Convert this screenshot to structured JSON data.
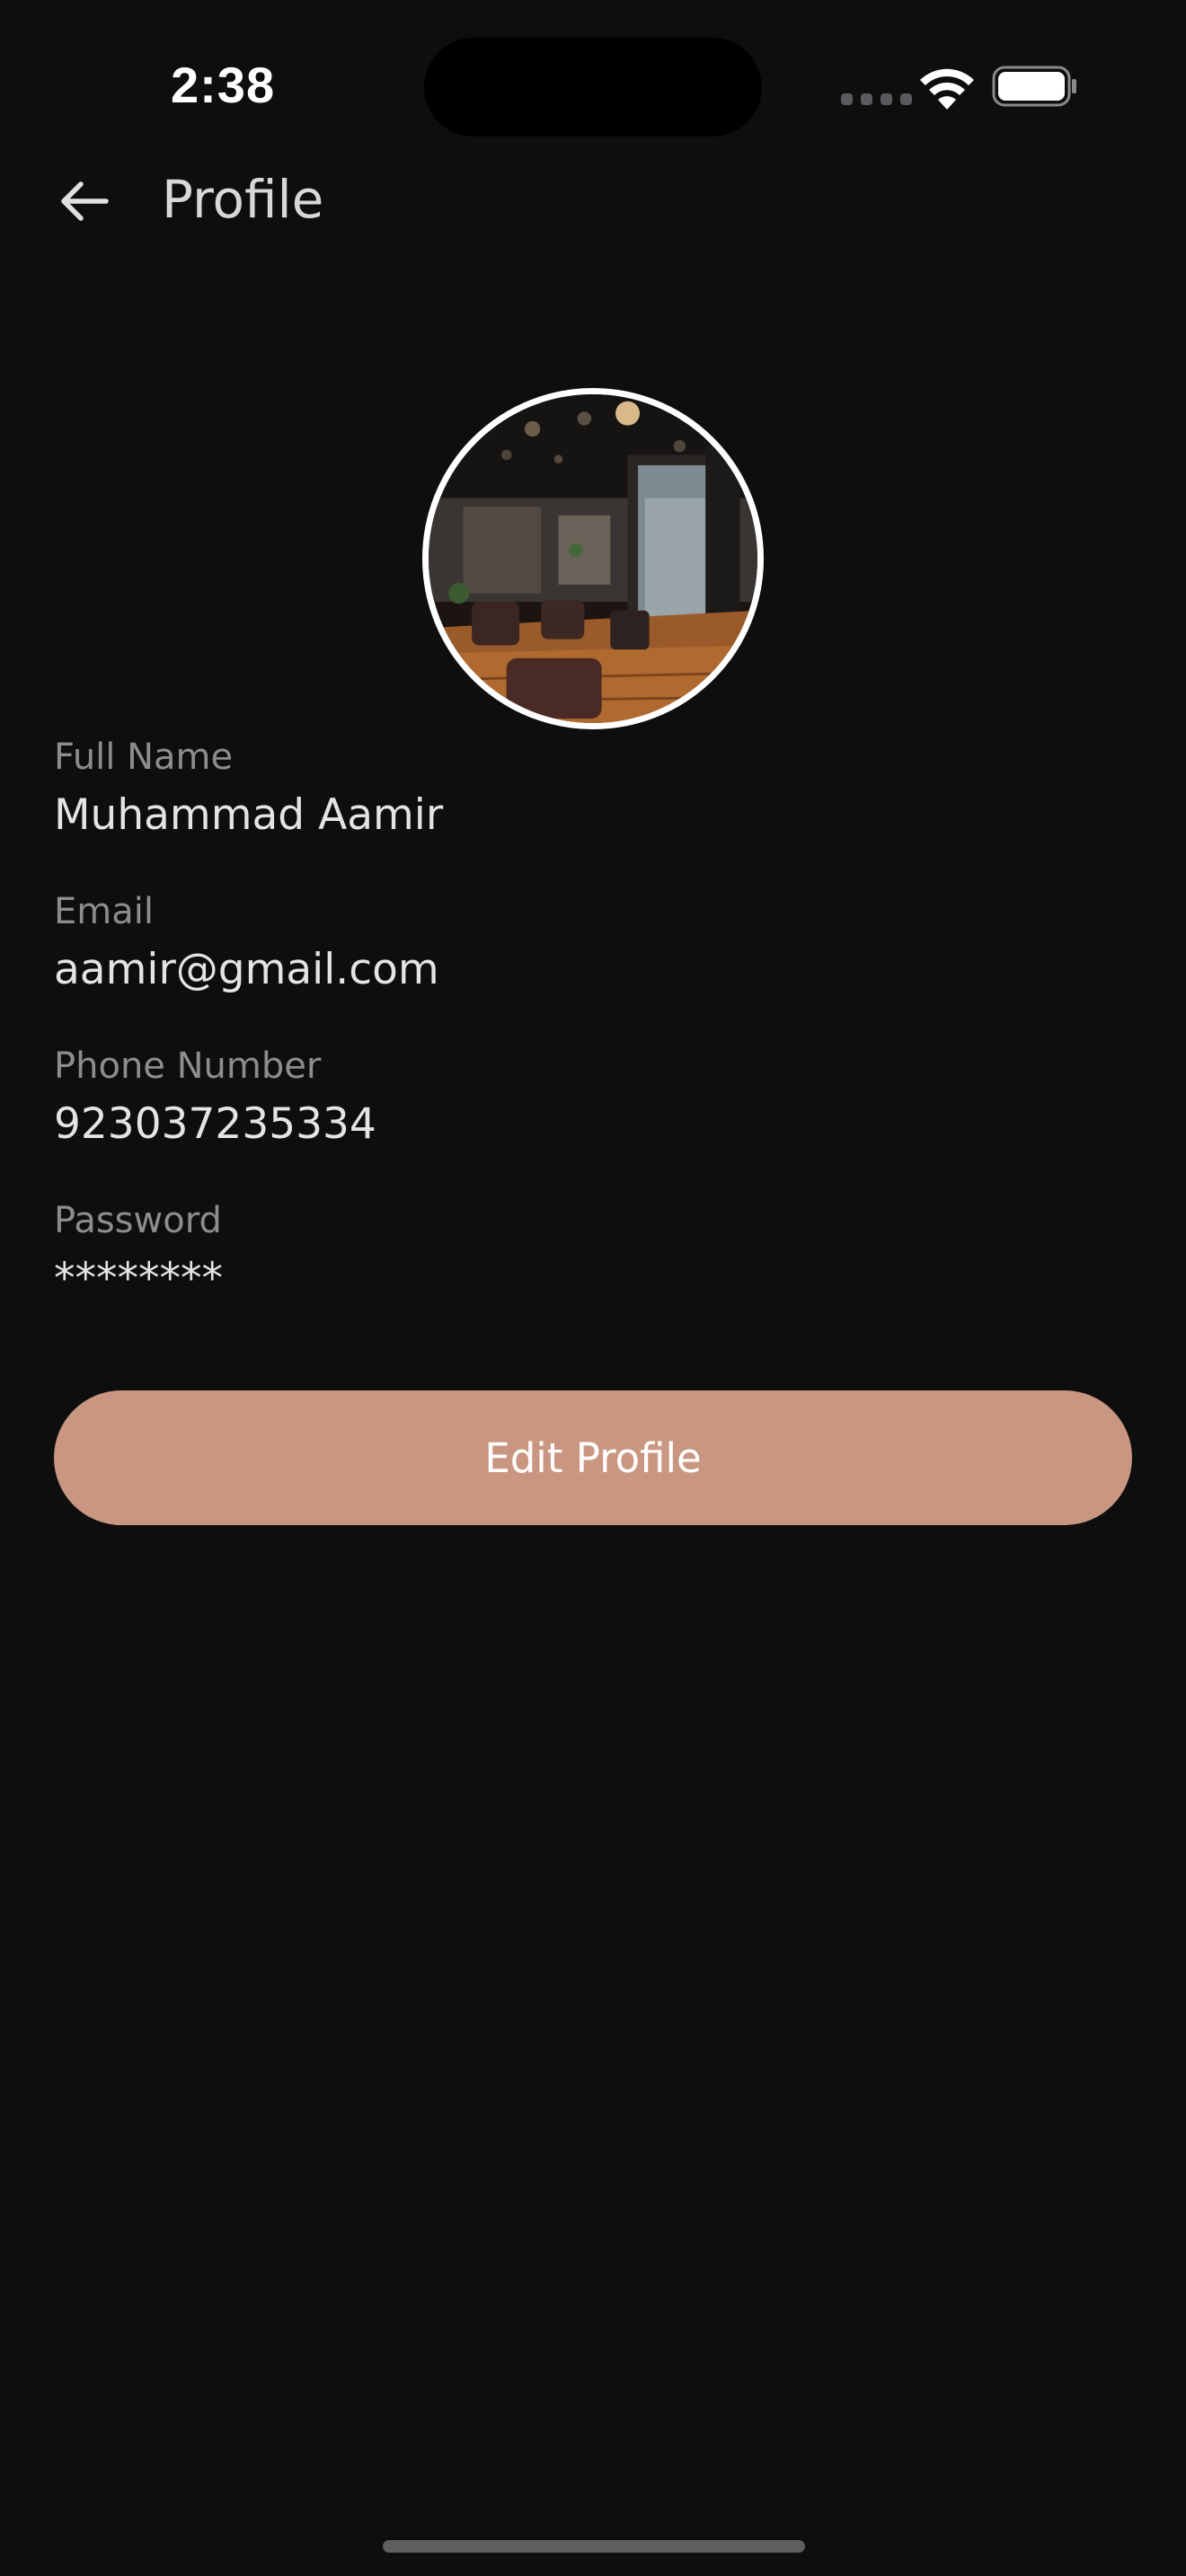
{
  "status_bar": {
    "time": "2:38",
    "icons": [
      "signal-dots-icon",
      "wifi-icon",
      "battery-icon"
    ]
  },
  "header": {
    "back_icon": "arrow-left-icon",
    "title": "Profile"
  },
  "avatar": {
    "description_icon": "salon-photo",
    "border_color": "#ffffff"
  },
  "fields": [
    {
      "label": "Full Name",
      "value": "Muhammad Aamir"
    },
    {
      "label": "Email",
      "value": "aamir@gmail.com"
    },
    {
      "label": "Phone Number",
      "value": "923037235334"
    },
    {
      "label": "Password",
      "value": "********"
    }
  ],
  "actions": {
    "edit_label": "Edit Profile"
  },
  "colors": {
    "background": "#0e0e0f",
    "accent": "#c99781",
    "label": "#8d8d8d",
    "value": "#e4e4e4"
  }
}
